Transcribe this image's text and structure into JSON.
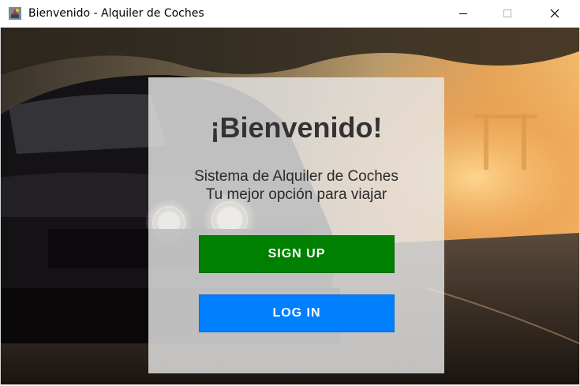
{
  "window": {
    "title": "Bienvenido - Alquiler de Coches",
    "controls": {
      "minimize": "minimize-icon",
      "maximize": "maximize-icon",
      "close": "close-icon"
    }
  },
  "panel": {
    "heading": "¡Bienvenido!",
    "subtitle_line1": "Sistema de Alquiler de Coches",
    "subtitle_line2": "Tu mejor opción para viajar"
  },
  "buttons": {
    "signup_label": "SIGN UP",
    "login_label": "LOG IN"
  },
  "colors": {
    "signup": "#008000",
    "login": "#0080ff",
    "panel": "#e6e6e6",
    "heading_text": "#333333"
  }
}
